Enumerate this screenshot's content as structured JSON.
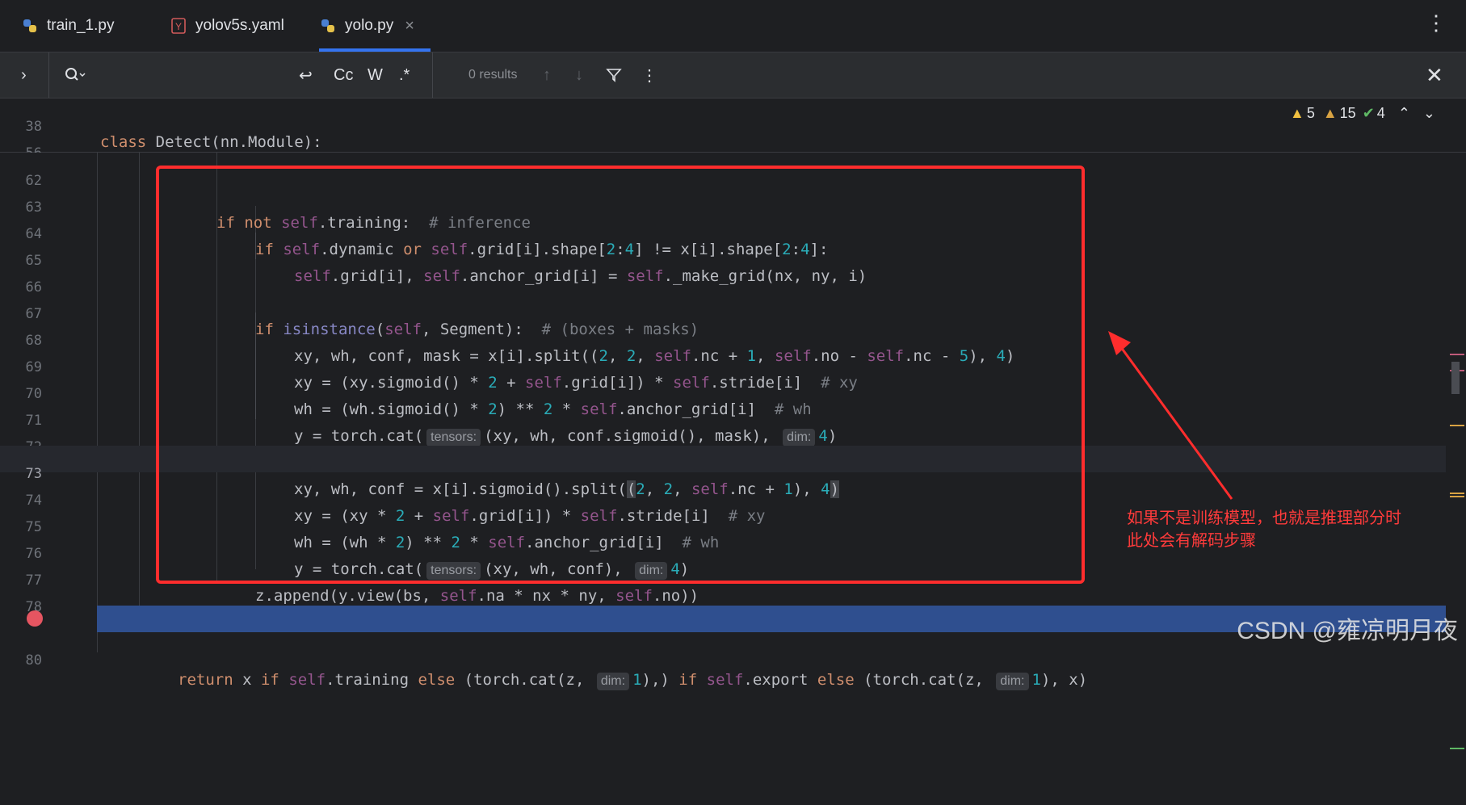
{
  "tabs": [
    {
      "label": "train_1.py",
      "icon": "python-icon"
    },
    {
      "label": "yolov5s.yaml",
      "icon": "yaml-icon"
    },
    {
      "label": "yolo.py",
      "icon": "python-icon"
    }
  ],
  "findbar": {
    "results_text": "0 results",
    "match_case": "Cc",
    "words": "W",
    "regex": ".*"
  },
  "inspections": {
    "warnings_a": "5",
    "warnings_b": "15",
    "ok": "4"
  },
  "sticky": [
    {
      "ln": "38"
    },
    {
      "ln": "56"
    }
  ],
  "lines": [
    {
      "ln": "62"
    },
    {
      "ln": "63"
    },
    {
      "ln": "64"
    },
    {
      "ln": "65"
    },
    {
      "ln": "66"
    },
    {
      "ln": "67"
    },
    {
      "ln": "68"
    },
    {
      "ln": "69"
    },
    {
      "ln": "70"
    },
    {
      "ln": "71"
    },
    {
      "ln": "72"
    },
    {
      "ln": "73"
    },
    {
      "ln": "74"
    },
    {
      "ln": "75"
    },
    {
      "ln": "76"
    },
    {
      "ln": "77"
    },
    {
      "ln": "78"
    },
    {
      "ln": ""
    },
    {
      "ln": "80"
    }
  ],
  "annotation": {
    "line1": "如果不是训练模型，也就是推理部分时",
    "line2": "此处会有解码步骤"
  },
  "watermark": "CSDN @雍凉明月夜",
  "colors": {
    "accent": "#3574f0",
    "exec_line": "#2f4f8f",
    "redbox": "#ff2d2d"
  }
}
